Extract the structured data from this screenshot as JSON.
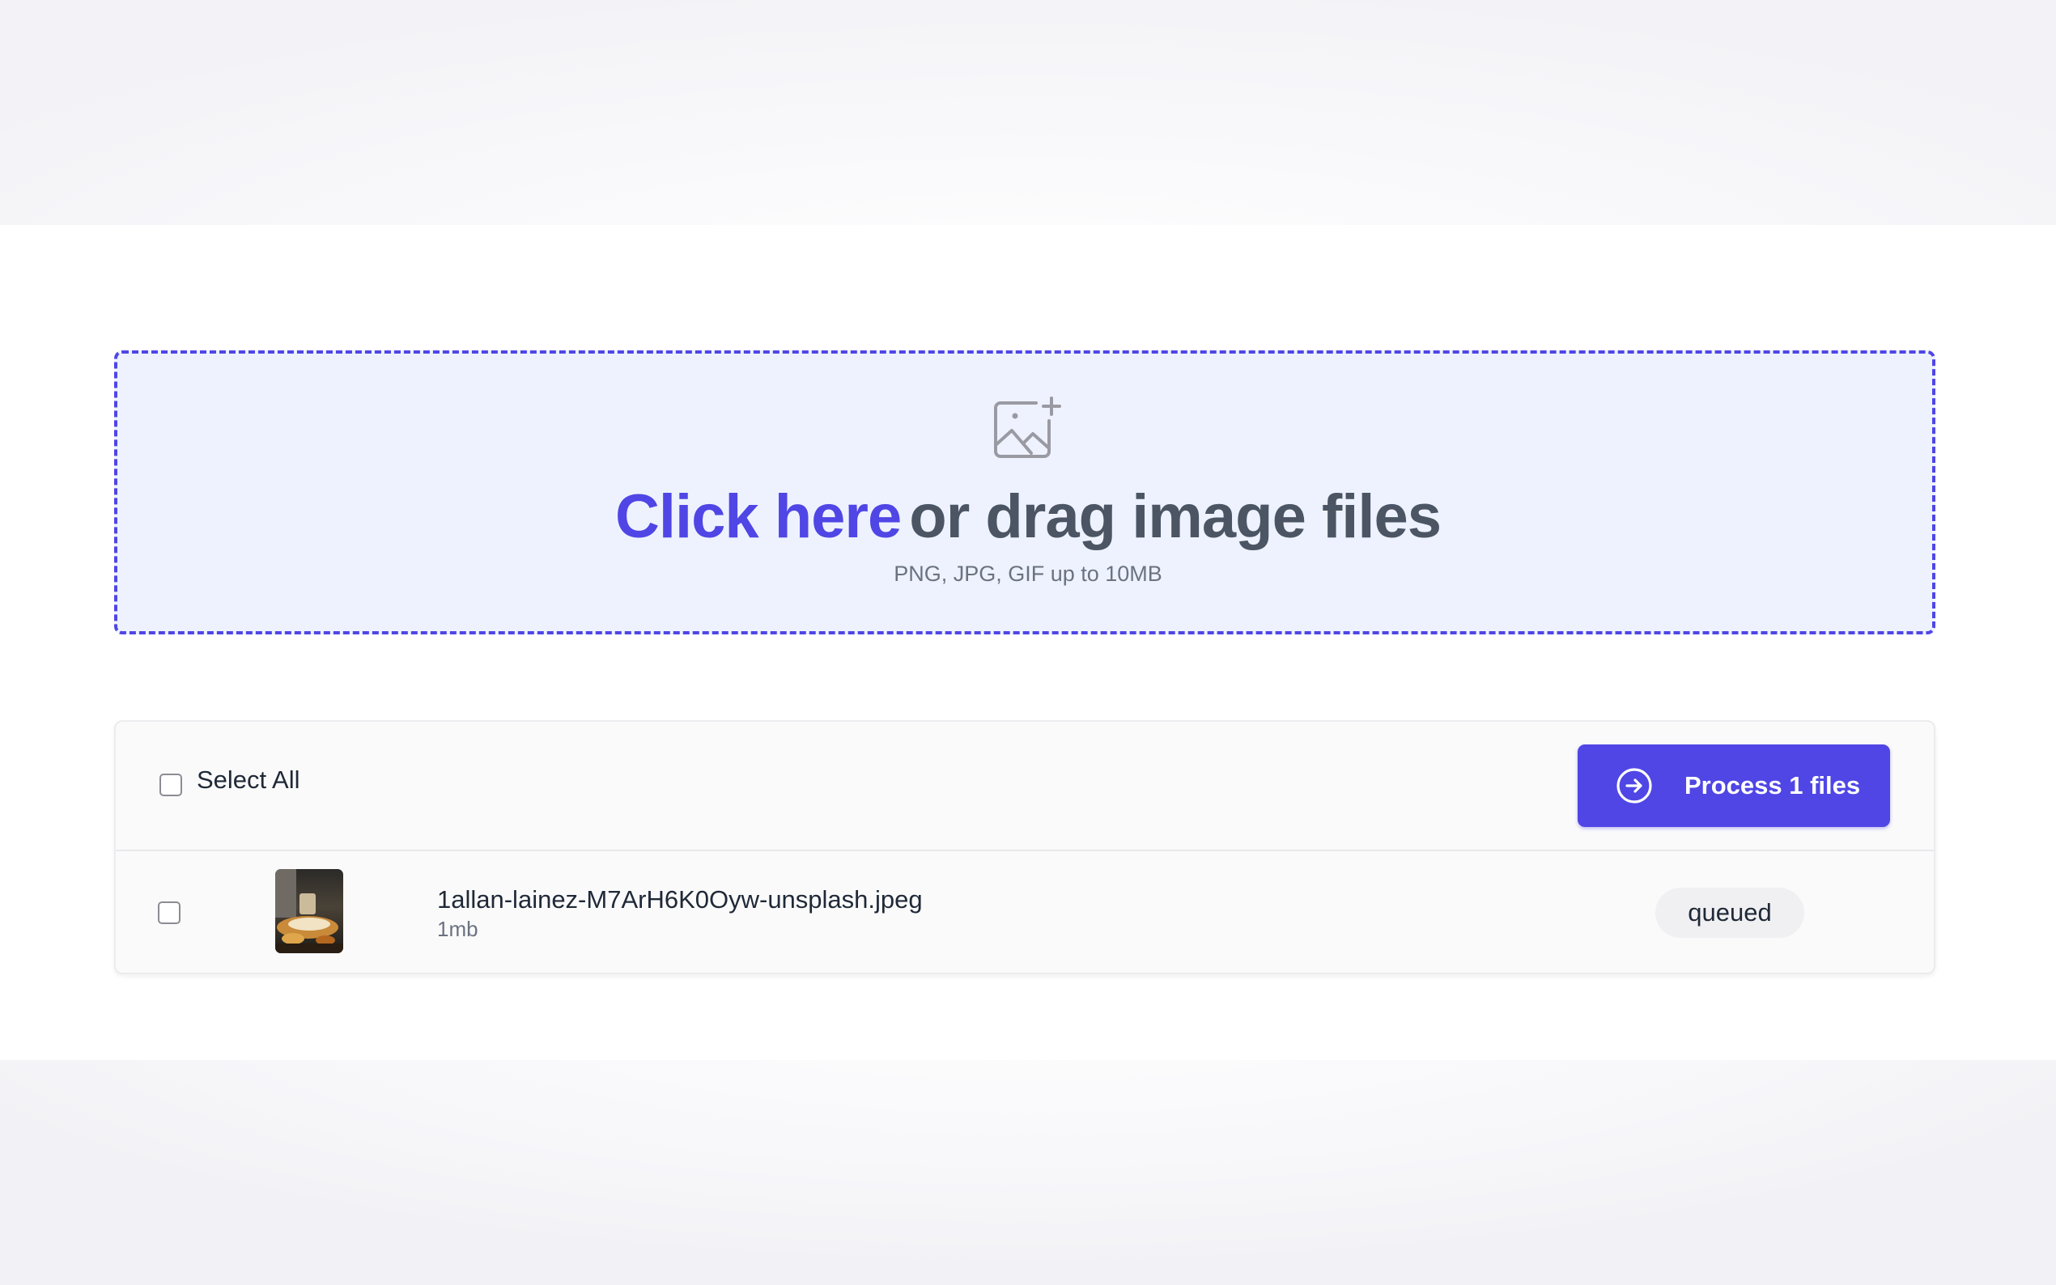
{
  "upload": {
    "link_text": "Click here",
    "rest_text": "or drag image files",
    "hint": "PNG, JPG, GIF up to 10MB",
    "icon": "image-plus-icon",
    "accent_color": "#4f46e5",
    "background_color": "#eef2ff"
  },
  "file_list": {
    "select_all_label": "Select All",
    "process_button_label": "Process 1 files",
    "process_button_icon": "arrow-right-circle-icon",
    "files": [
      {
        "name": "1allan-lainez-M7ArH6K0Oyw-unsplash.jpeg",
        "size": "1mb",
        "status": "queued",
        "checked": false
      }
    ],
    "select_all_checked": false
  }
}
